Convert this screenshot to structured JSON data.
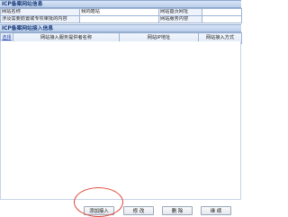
{
  "icp_section": {
    "title": "ICP备案网站信息",
    "rows": [
      {
        "label": "网站名称",
        "value": "我的酷站",
        "label2": "网站首页网址",
        "value2": ""
      },
      {
        "label": "涉及需要前置或专项审批的内容",
        "value": "",
        "label2": "网站服务内容",
        "value2": ""
      }
    ]
  },
  "access_section": {
    "title": "ICP备案网站接入信息",
    "columns": [
      "选择",
      "网站接入服务提供者名称",
      "网站IP地址",
      "网站接入方式"
    ]
  },
  "buttons": {
    "add": "添加接入",
    "edit": "修 改",
    "delete": "删 除",
    "continue": "继 续"
  },
  "colors": {
    "header_bg": "#b9cdea",
    "header_text": "#1a3c7a",
    "grid_border": "#9fb3d3",
    "highlight": "#e04a3a"
  }
}
